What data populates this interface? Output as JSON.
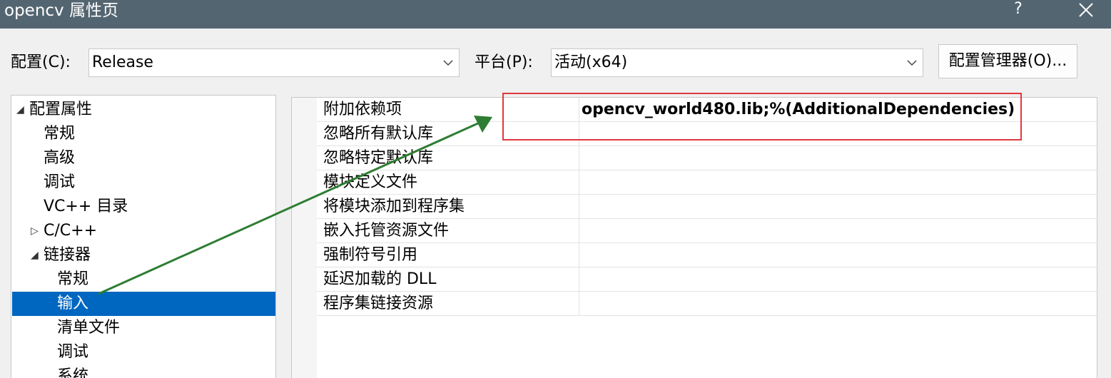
{
  "window": {
    "title": "opencv 属性页",
    "help_label": "?"
  },
  "toolbar": {
    "config_label": "配置(C):",
    "config_value": "Release",
    "platform_label": "平台(P):",
    "platform_value": "活动(x64)",
    "manager_button": "配置管理器(O)..."
  },
  "tree": {
    "items": [
      {
        "label": "配置属性",
        "expander": "◢"
      },
      {
        "label": "常规"
      },
      {
        "label": "高级"
      },
      {
        "label": "调试"
      },
      {
        "label": "VC++ 目录"
      },
      {
        "label": "C/C++",
        "expander": "▷"
      },
      {
        "label": "链接器",
        "expander": "◢"
      },
      {
        "label": "常规"
      },
      {
        "label": "输入",
        "selected": true
      },
      {
        "label": "清单文件"
      },
      {
        "label": "调试"
      },
      {
        "label": "系统"
      }
    ]
  },
  "properties": [
    {
      "name": "附加依赖项",
      "value": "opencv_world480.lib;%(AdditionalDependencies)"
    },
    {
      "name": "忽略所有默认库",
      "value": ""
    },
    {
      "name": "忽略特定默认库",
      "value": ""
    },
    {
      "name": "模块定义文件",
      "value": ""
    },
    {
      "name": "将模块添加到程序集",
      "value": ""
    },
    {
      "name": "嵌入托管资源文件",
      "value": ""
    },
    {
      "name": "强制符号引用",
      "value": ""
    },
    {
      "name": "延迟加载的 DLL",
      "value": ""
    },
    {
      "name": "程序集链接资源",
      "value": ""
    }
  ],
  "colors": {
    "titlebar": "#536571",
    "selection": "#0067c0",
    "annotation_box": "#e0393e",
    "annotation_arrow": "#2e7d32"
  }
}
